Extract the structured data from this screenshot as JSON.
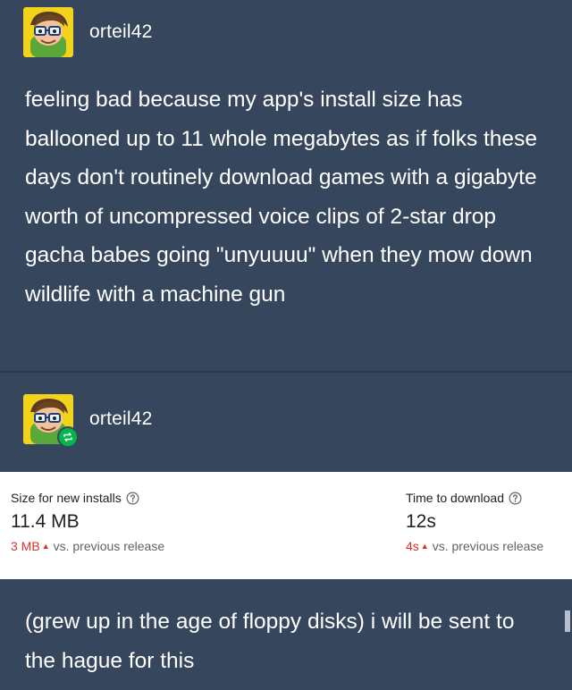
{
  "post1": {
    "username": "orteil42",
    "text": "feeling bad because my app's install size has ballooned up to 11 whole megabytes as if folks these days don't routinely download games with a gigabyte worth of uncompressed voice clips of 2-star drop gacha babes going \"unyuuuu\" when they mow down wildlife with a machine gun"
  },
  "post2": {
    "username": "orteil42",
    "stats": {
      "size": {
        "label": "Size for new installs",
        "value": "11.4 MB",
        "delta": "3 MB",
        "comparison": "vs. previous release"
      },
      "time": {
        "label": "Time to download",
        "value": "12s",
        "delta": "4s",
        "comparison": "vs. previous release"
      }
    },
    "text": "(grew up in the age of floppy disks) i will be sent to the hague for this"
  },
  "colors": {
    "background": "#36465d",
    "embed_background": "#ffffff",
    "delta_red": "#d93025",
    "reblog_green": "#00b84a"
  }
}
